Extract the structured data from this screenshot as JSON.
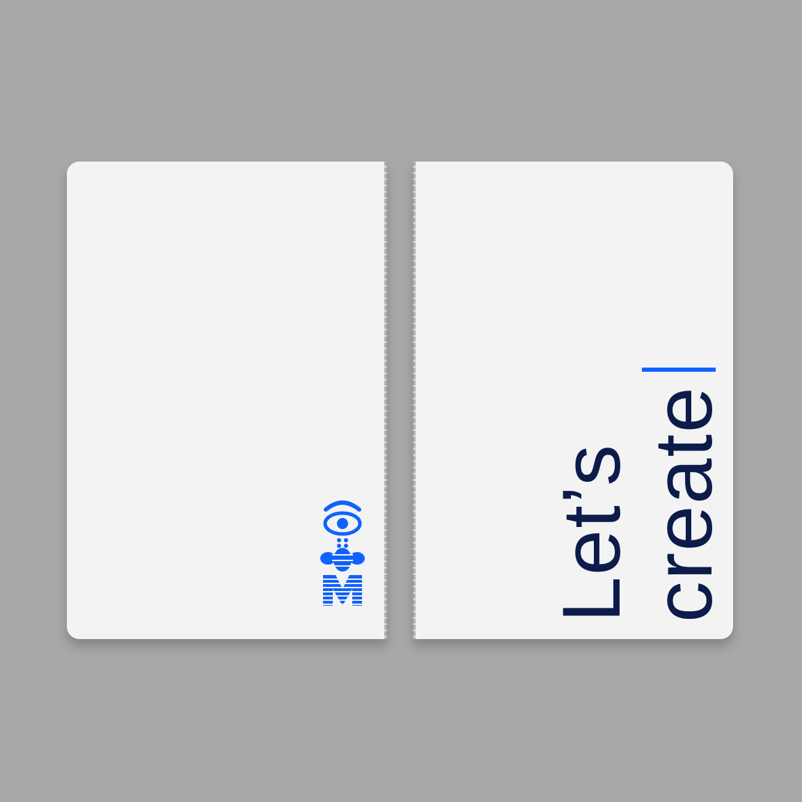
{
  "cover": {
    "headline_line1": "Let’s",
    "headline_line2": "create",
    "accent_color": "#0f62fe",
    "text_color": "#0c1b4a",
    "panel_color": "#f3f3f3",
    "background_color": "#a8a8a8",
    "logo_icon": "eye-bee-m-rebus-logo"
  }
}
